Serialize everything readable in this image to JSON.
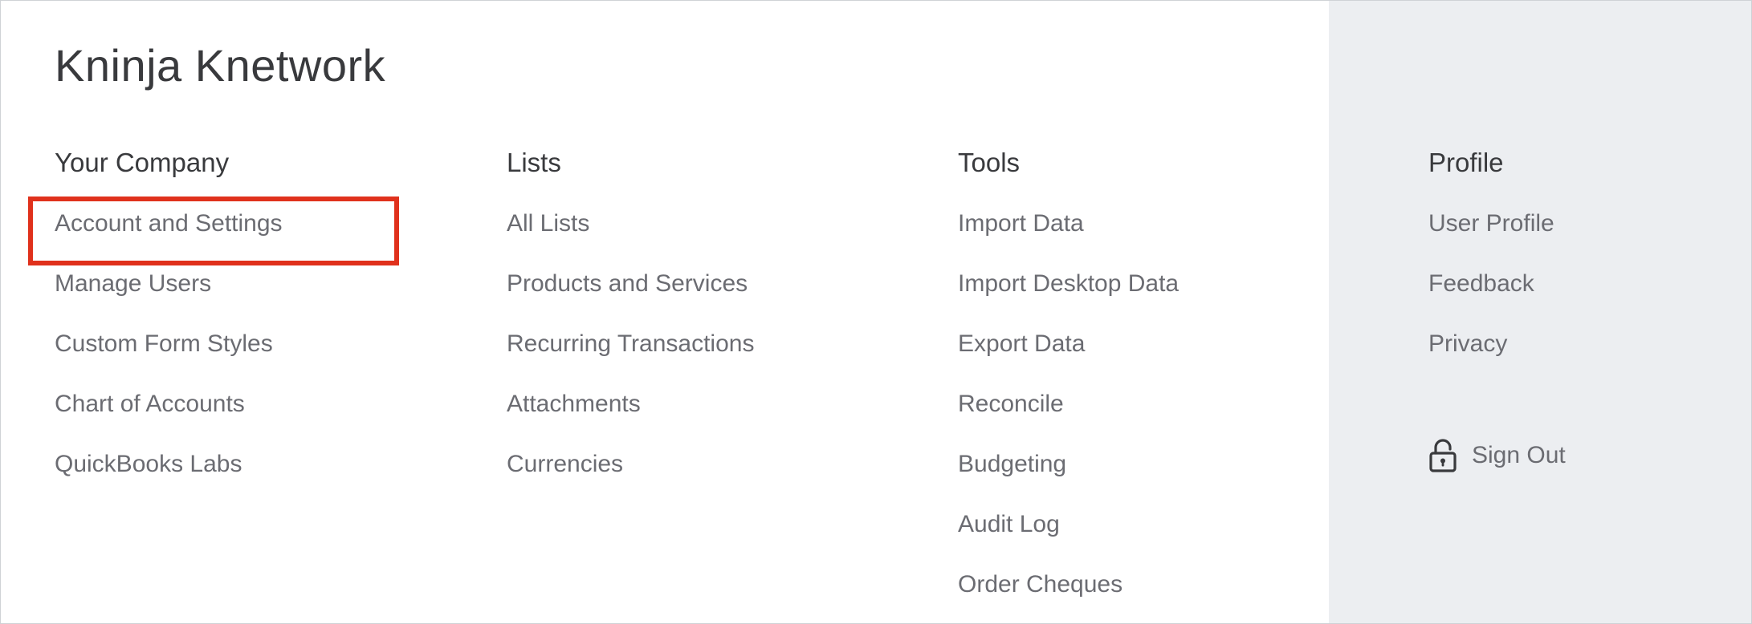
{
  "company_name": "Kninja Knetwork",
  "columns": {
    "your_company": {
      "heading": "Your Company",
      "items": [
        "Account and Settings",
        "Manage Users",
        "Custom Form Styles",
        "Chart of Accounts",
        "QuickBooks Labs"
      ]
    },
    "lists": {
      "heading": "Lists",
      "items": [
        "All Lists",
        "Products and Services",
        "Recurring Transactions",
        "Attachments",
        "Currencies"
      ]
    },
    "tools": {
      "heading": "Tools",
      "items": [
        "Import Data",
        "Import Desktop Data",
        "Export Data",
        "Reconcile",
        "Budgeting",
        "Audit Log",
        "Order Cheques"
      ]
    },
    "profile": {
      "heading": "Profile",
      "items": [
        "User Profile",
        "Feedback",
        "Privacy"
      ],
      "sign_out_label": "Sign Out"
    }
  },
  "icons": {
    "sign_out": "lock-icon"
  },
  "colors": {
    "highlight": "#e0311c",
    "profile_panel_bg": "#eceef1",
    "heading_text": "#393a3d",
    "item_text": "#6b6c72"
  }
}
